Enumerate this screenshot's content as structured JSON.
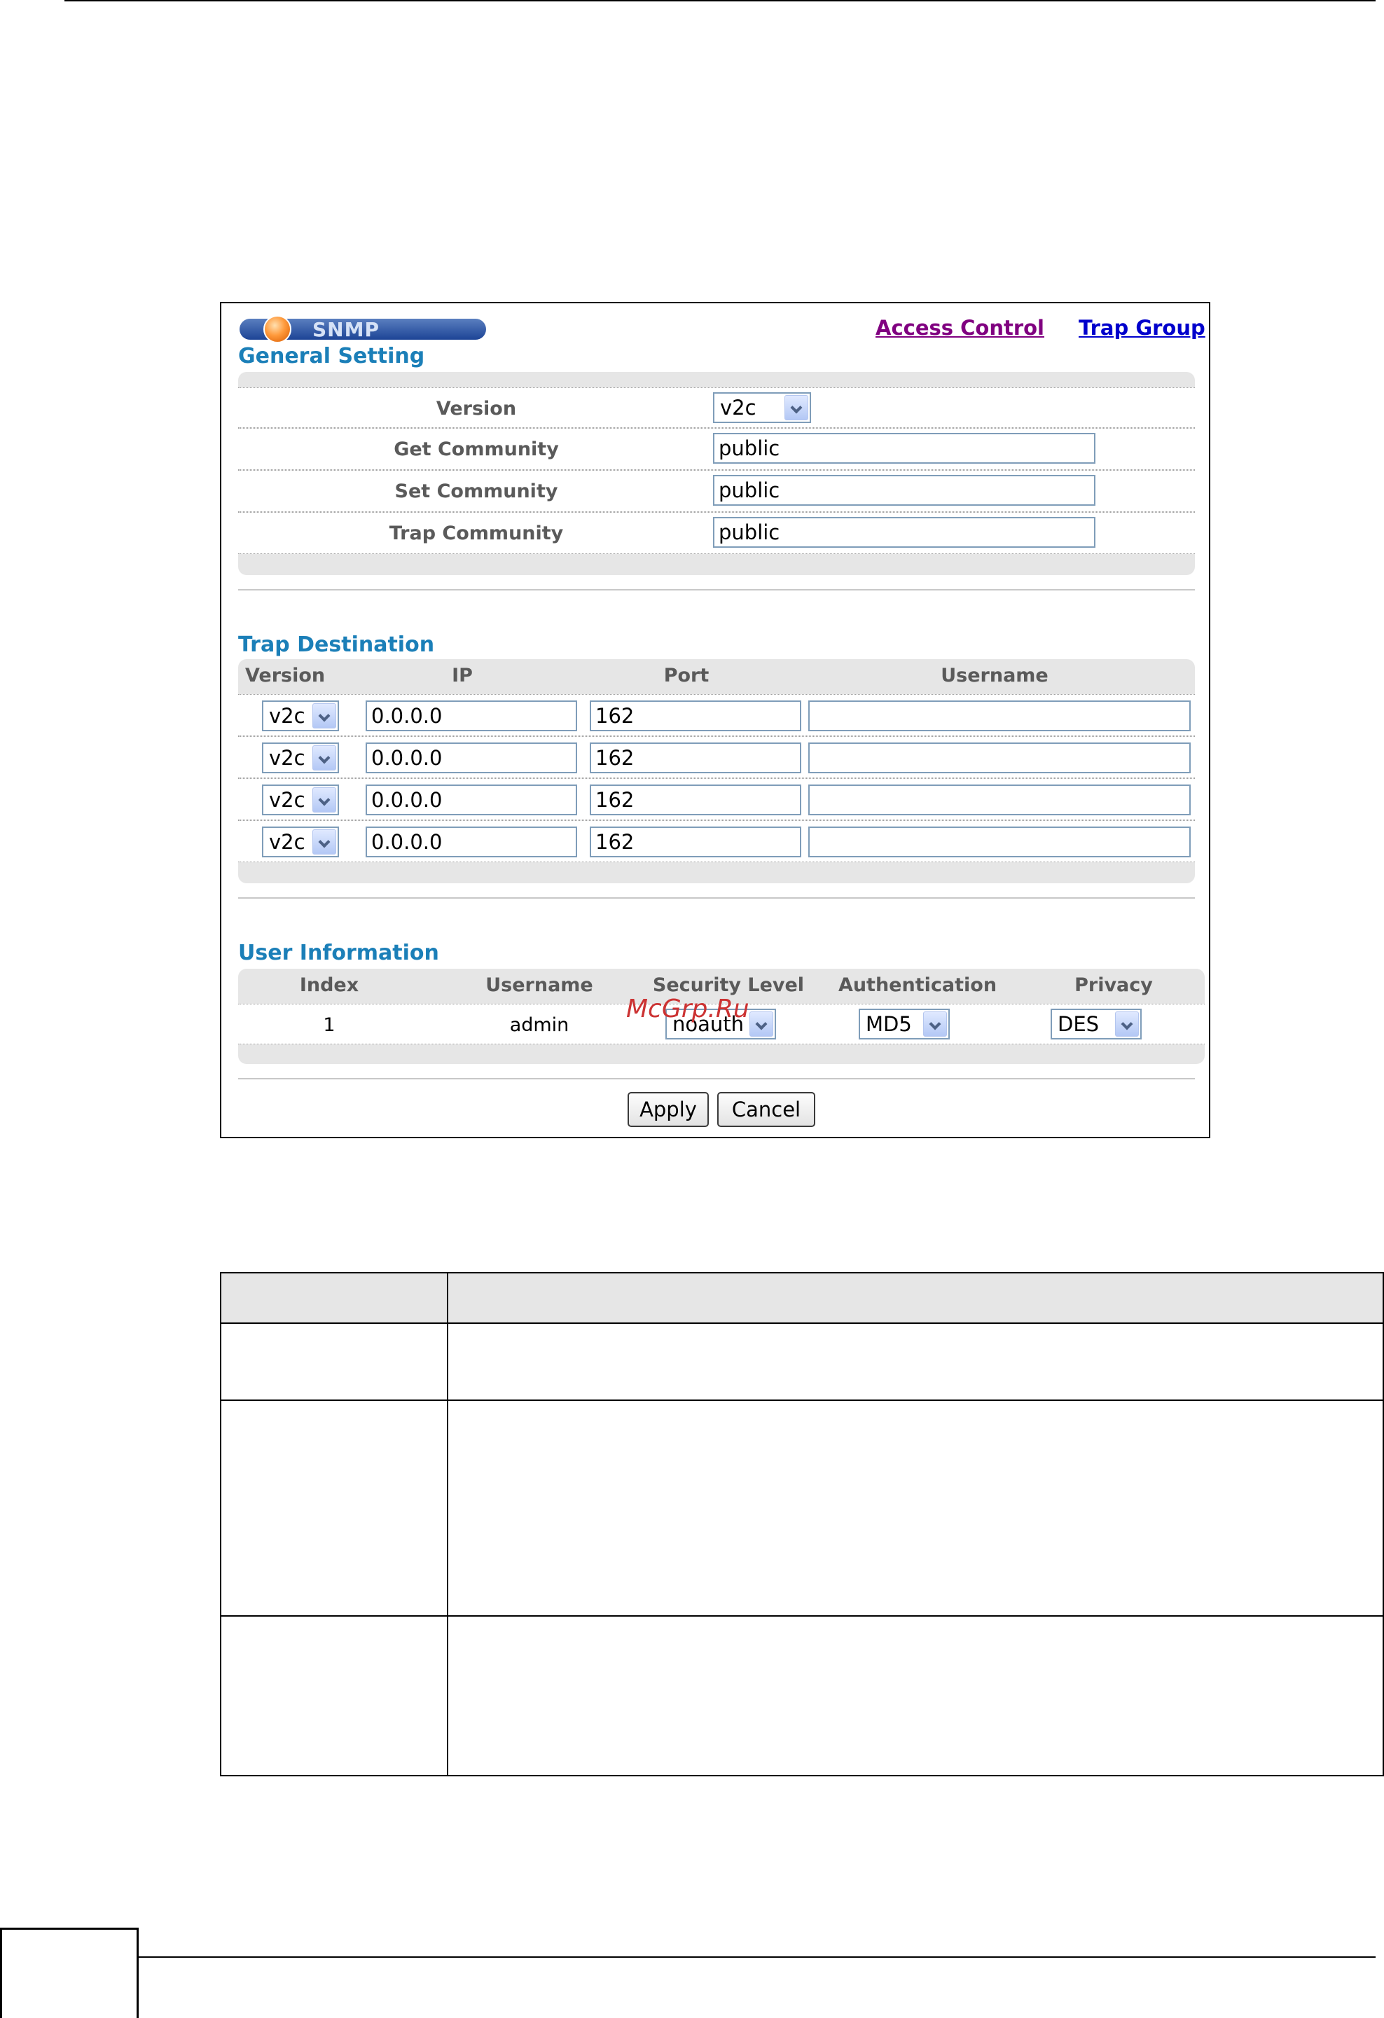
{
  "panel": {
    "logo_text": "SNMP",
    "links": [
      "Access Control",
      "Trap Group"
    ],
    "general_setting": {
      "title": "General Setting",
      "version_label": "Version",
      "version_value": "v2c",
      "get_community_label": "Get Community",
      "get_community_value": "public",
      "set_community_label": "Set Community",
      "set_community_value": "public",
      "trap_community_label": "Trap Community",
      "trap_community_value": "public"
    },
    "trap_destination": {
      "title": "Trap Destination",
      "headers": [
        "Version",
        "IP",
        "Port",
        "Username"
      ],
      "rows": [
        {
          "version": "v2c",
          "ip": "0.0.0.0",
          "port": "162",
          "username": ""
        },
        {
          "version": "v2c",
          "ip": "0.0.0.0",
          "port": "162",
          "username": ""
        },
        {
          "version": "v2c",
          "ip": "0.0.0.0",
          "port": "162",
          "username": ""
        },
        {
          "version": "v2c",
          "ip": "0.0.0.0",
          "port": "162",
          "username": ""
        }
      ]
    },
    "user_information": {
      "title": "User Information",
      "headers": [
        "Index",
        "Username",
        "Security Level",
        "Authentication",
        "Privacy"
      ],
      "row": {
        "index": "1",
        "username": "admin",
        "security_level": "noauth",
        "authentication": "MD5",
        "privacy": "DES"
      }
    },
    "buttons": {
      "apply": "Apply",
      "cancel": "Cancel"
    },
    "watermark": "McGrp.Ru"
  },
  "colors": {
    "section_title": "#1b7fb8",
    "link_visited": "#800080",
    "link": "#0000cc"
  }
}
